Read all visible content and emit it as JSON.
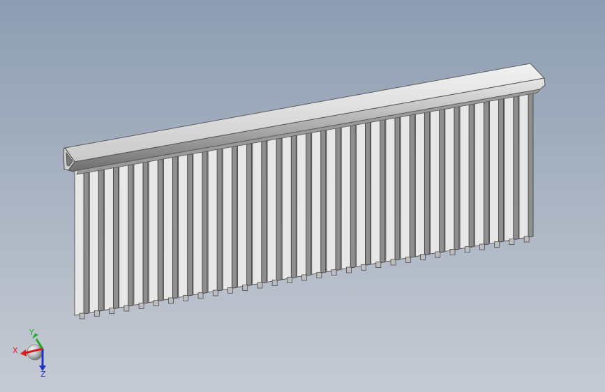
{
  "viewport": {
    "background_top": "#8d9db2",
    "background_bottom": "#c6cbd3"
  },
  "model": {
    "rail_color": "#d9d9d9",
    "slat_face_color": "#e7e7e7",
    "slat_side_color": "#8f8f8f",
    "slat_count": 31
  },
  "triad": {
    "x_label": "X",
    "y_label": "Y",
    "z_label": "Z",
    "x_color": "#d21e1e",
    "y_color": "#1faa2a",
    "z_color": "#1d33c8"
  }
}
